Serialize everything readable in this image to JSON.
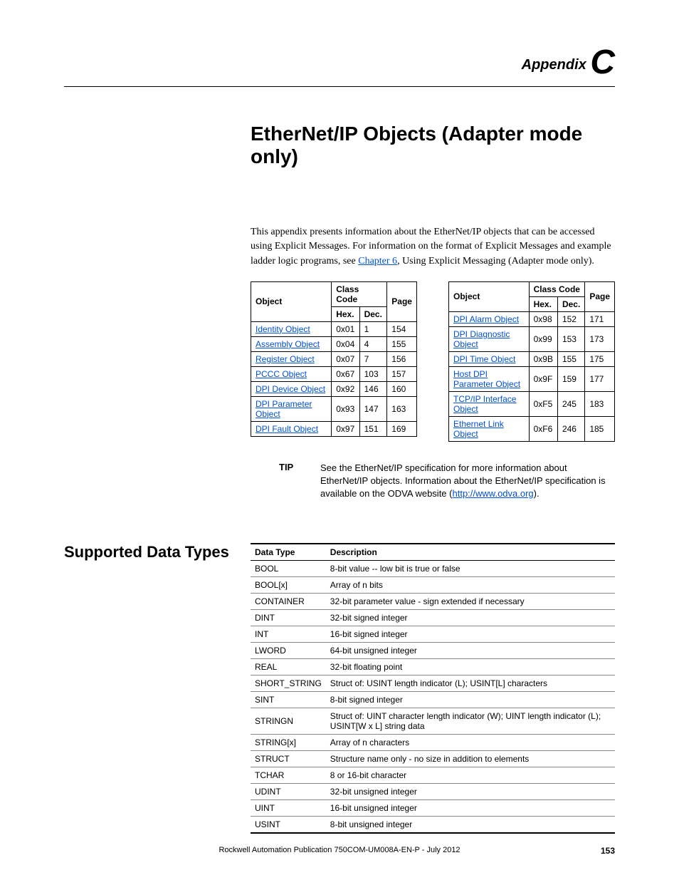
{
  "header": {
    "appendix_word": "Appendix",
    "letter": "C"
  },
  "title": "EtherNet/IP Objects (Adapter mode only)",
  "intro": {
    "p1a": "This appendix presents information about the EtherNet/IP objects that can be accessed using Explicit Messages. For information on the format of Explicit Messages and example ladder logic programs, see ",
    "chapter_link": "Chapter 6",
    "p1b": ", Using Explicit Messaging (Adapter mode only)."
  },
  "obj_table_headers": {
    "object": "Object",
    "class_code": "Class Code",
    "page": "Page",
    "hex": "Hex.",
    "dec": "Dec."
  },
  "objects_left": [
    {
      "name": "Identity Object",
      "hex": "0x01",
      "dec": "1",
      "page": "154"
    },
    {
      "name": "Assembly Object",
      "hex": "0x04",
      "dec": "4",
      "page": "155"
    },
    {
      "name": "Register Object",
      "hex": "0x07",
      "dec": "7",
      "page": "156"
    },
    {
      "name": "PCCC Object",
      "hex": "0x67",
      "dec": "103",
      "page": "157"
    },
    {
      "name": "DPI Device Object",
      "hex": "0x92",
      "dec": "146",
      "page": "160"
    },
    {
      "name": "DPI Parameter Object",
      "hex": "0x93",
      "dec": "147",
      "page": "163"
    },
    {
      "name": "DPI Fault Object",
      "hex": "0x97",
      "dec": "151",
      "page": "169"
    }
  ],
  "objects_right": [
    {
      "name": "DPI Alarm Object",
      "hex": "0x98",
      "dec": "152",
      "page": "171"
    },
    {
      "name": "DPI Diagnostic Object",
      "hex": "0x99",
      "dec": "153",
      "page": "173"
    },
    {
      "name": "DPI Time Object",
      "hex": "0x9B",
      "dec": "155",
      "page": "175"
    },
    {
      "name": "Host DPI Parameter Object",
      "hex": "0x9F",
      "dec": "159",
      "page": "177"
    },
    {
      "name": "TCP/IP Interface Object",
      "hex": "0xF5",
      "dec": "245",
      "page": "183"
    },
    {
      "name": "Ethernet Link Object",
      "hex": "0xF6",
      "dec": "246",
      "page": "185"
    }
  ],
  "tip": {
    "label": "TIP",
    "text_a": "See the EtherNet/IP specification for more information about EtherNet/IP objects. Information about the EtherNet/IP specification is available on the ODVA website (",
    "url": "http://www.odva.org",
    "text_b": ")."
  },
  "datatypes_heading": "Supported Data Types",
  "dt_headers": {
    "type": "Data Type",
    "desc": "Description"
  },
  "datatypes": [
    {
      "t": "BOOL",
      "d": "8-bit value -- low bit is true or false"
    },
    {
      "t": "BOOL[x]",
      "d": "Array of n bits"
    },
    {
      "t": "CONTAINER",
      "d": "32-bit parameter value - sign extended if necessary"
    },
    {
      "t": "DINT",
      "d": "32-bit signed integer"
    },
    {
      "t": "INT",
      "d": "16-bit signed integer"
    },
    {
      "t": "LWORD",
      "d": "64-bit unsigned integer"
    },
    {
      "t": "REAL",
      "d": "32-bit floating point"
    },
    {
      "t": "SHORT_STRING",
      "d": "Struct of: USINT length indicator (L); USINT[L] characters"
    },
    {
      "t": "SINT",
      "d": "8-bit signed integer"
    },
    {
      "t": "STRINGN",
      "d": "Struct of: UINT character length indicator (W); UINT length indicator (L); USINT[W x L] string data"
    },
    {
      "t": "STRING[x]",
      "d": "Array of n characters"
    },
    {
      "t": "STRUCT",
      "d": "Structure name only - no size in addition to elements"
    },
    {
      "t": "TCHAR",
      "d": "8 or 16-bit character"
    },
    {
      "t": "UDINT",
      "d": "32-bit unsigned integer"
    },
    {
      "t": "UINT",
      "d": "16-bit unsigned integer"
    },
    {
      "t": "USINT",
      "d": "8-bit unsigned integer"
    }
  ],
  "footer": {
    "pub": "Rockwell Automation Publication 750COM-UM008A-EN-P - July 2012",
    "page": "153"
  }
}
